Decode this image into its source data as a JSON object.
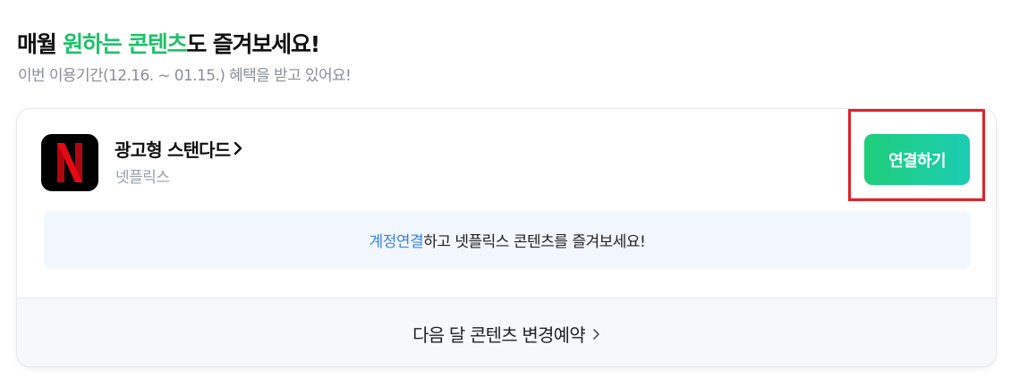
{
  "header": {
    "title_part1": "매월 ",
    "title_highlight": "원하는 콘텐츠",
    "title_part2": "도 즐겨보세요!",
    "subtitle": "이번 이용기간(12.16. ~ 01.15.) 혜택을 받고 있어요!"
  },
  "subscription": {
    "logo_letter": "N",
    "plan_name": "광고형 스탠다드",
    "plan_chevron": "›",
    "provider": "넷플릭스",
    "connect_button_label": "연결하기"
  },
  "notice": {
    "link_text": "계정연결",
    "rest_text": "하고 넷플릭스 콘텐츠를 즐겨보세요!"
  },
  "footer": {
    "label": "다음 달 콘텐츠 변경예약",
    "chevron": "›"
  },
  "colors": {
    "accent_green": "#1fc16b",
    "button_gradient_start": "#1fce7a",
    "button_gradient_end": "#1ccdb4",
    "link_blue": "#3c82e6",
    "highlight_red": "#e0202a",
    "netflix_red": "#e50914"
  },
  "icons": {
    "logo": "netflix-logo",
    "plan_chevron": "chevron-right-icon",
    "footer_chevron": "chevron-right-icon"
  }
}
